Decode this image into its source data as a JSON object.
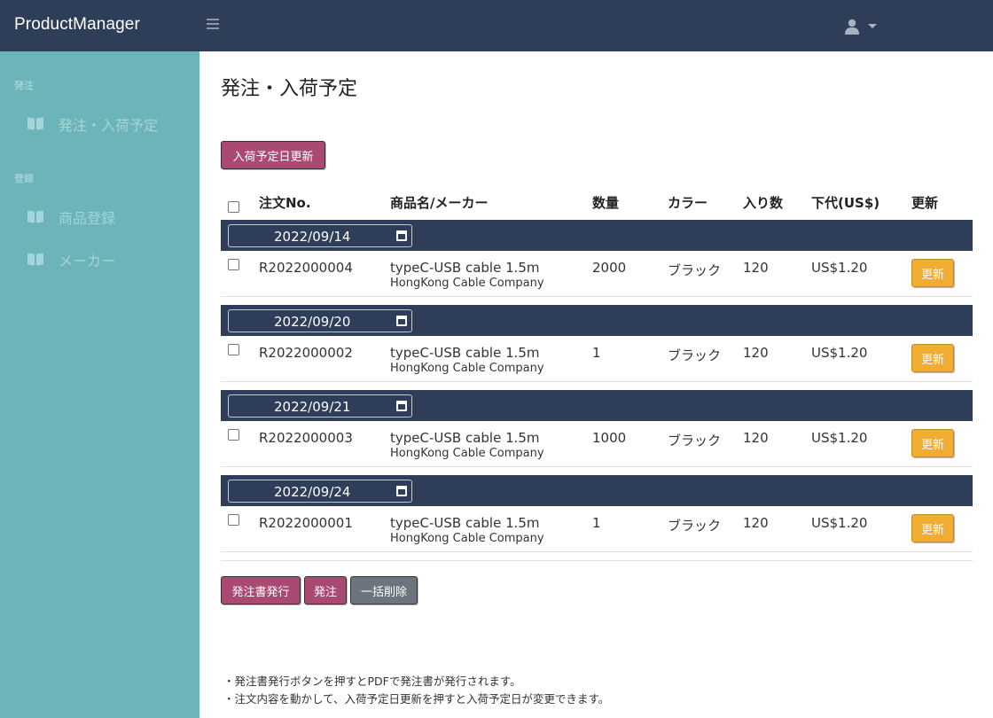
{
  "header": {
    "brand": "ProductManager",
    "menu_icon": "hamburger-icon",
    "user_icon": "user-icon"
  },
  "sidebar": {
    "sections": [
      {
        "label": "発注",
        "items": [
          {
            "label": "発注・入荷予定",
            "icon": "book-icon"
          }
        ]
      },
      {
        "label": "登録",
        "items": [
          {
            "label": "商品登録",
            "icon": "book-icon"
          },
          {
            "label": "メーカー",
            "icon": "book-icon"
          }
        ]
      }
    ]
  },
  "main": {
    "title": "発注・入荷予定",
    "update_date_button": "入荷予定日更新",
    "columns": [
      "注文No.",
      "商品名/メーカー",
      "数量",
      "カラー",
      "入り数",
      "下代(US$)",
      "更新"
    ],
    "groups": [
      {
        "date": "2022/09/14",
        "order_no": "R2022000004",
        "product": "typeC-USB cable 1.5m",
        "maker": "HongKong Cable Company",
        "qty": "2000",
        "color": "ブラック",
        "per_box": "120",
        "price": "US$1.20",
        "update_label": "更新"
      },
      {
        "date": "2022/09/20",
        "order_no": "R2022000002",
        "product": "typeC-USB cable 1.5m",
        "maker": "HongKong Cable Company",
        "qty": "1",
        "color": "ブラック",
        "per_box": "120",
        "price": "US$1.20",
        "update_label": "更新"
      },
      {
        "date": "2022/09/21",
        "order_no": "R2022000003",
        "product": "typeC-USB cable 1.5m",
        "maker": "HongKong Cable Company",
        "qty": "1000",
        "color": "ブラック",
        "per_box": "120",
        "price": "US$1.20",
        "update_label": "更新"
      },
      {
        "date": "2022/09/24",
        "order_no": "R2022000001",
        "product": "typeC-USB cable 1.5m",
        "maker": "HongKong Cable Company",
        "qty": "1",
        "color": "ブラック",
        "per_box": "120",
        "price": "US$1.20",
        "update_label": "更新"
      }
    ],
    "actions": {
      "issue_po": "発注書発行",
      "order": "発注",
      "bulk_delete": "一括削除"
    },
    "notes": [
      "・発注書発行ボタンを押すとPDFで発注書が発行されます。",
      "・注文内容を動かして、入荷予定日更新を押すと入荷予定日が変更できます。"
    ]
  },
  "colors": {
    "topbar": "#2e3d58",
    "sidebar": "#6cb4b8",
    "primary": "#a94a72",
    "secondary": "#6c757d",
    "update": "#f0ad33"
  }
}
